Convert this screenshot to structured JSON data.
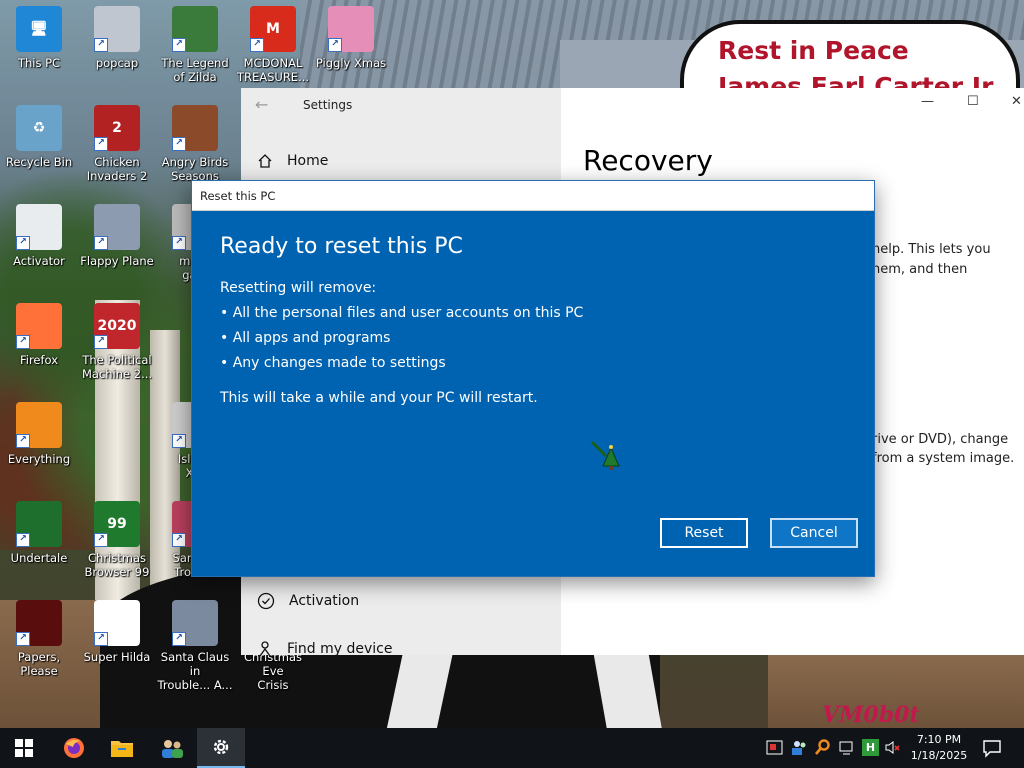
{
  "desktop": {
    "sign_line1": "Rest in Peace",
    "sign_line2": "James Earl Carter Jr.",
    "watermark": "VM0b0t",
    "icons": [
      {
        "label": "This PC",
        "color": "#1f87d6",
        "glyph": "🖥"
      },
      {
        "label": "popcap",
        "color": "#c0c6cf",
        "glyph": ""
      },
      {
        "label": "The Legend\nof Zilda",
        "color": "#3a7a3a",
        "glyph": ""
      },
      {
        "label": "MCDONAL\nTREASURE...",
        "color": "#d92b1c",
        "glyph": "M"
      },
      {
        "label": "Piggly Xmas",
        "color": "#e58fb8",
        "glyph": ""
      },
      {
        "label": "Recycle Bin",
        "color": "#6aa3c9",
        "glyph": "♻"
      },
      {
        "label": "Chicken\nInvaders 2",
        "color": "#b22222",
        "glyph": "2"
      },
      {
        "label": "Angry Birds\nSeasons",
        "color": "#8b4a2a",
        "glyph": ""
      },
      {
        "label": "Activator",
        "color": "#e9ecef",
        "glyph": ""
      },
      {
        "label": "Flappy Plane",
        "color": "#8c9bb0",
        "glyph": ""
      },
      {
        "label": "mcdo\ngam",
        "color": "#bbbbbb",
        "glyph": ""
      },
      {
        "label": "Firefox",
        "color": "#ff7139",
        "glyph": ""
      },
      {
        "label": "The Political\nMachine 2...",
        "color": "#c0272d",
        "glyph": "2020"
      },
      {
        "label": "Everything",
        "color": "#f08a1c",
        "glyph": ""
      },
      {
        "label": "Island\nXm",
        "color": "#cccccc",
        "glyph": ""
      },
      {
        "label": "Undertale",
        "color": "#1e6f2d",
        "glyph": ""
      },
      {
        "label": "Christmas\nBrowser 99",
        "color": "#1f7a2e",
        "glyph": "99"
      },
      {
        "label": "Santa C\nTrouble",
        "color": "#b8405e",
        "glyph": ""
      },
      {
        "label": "Papers, Please",
        "color": "#5a0d0d",
        "glyph": ""
      },
      {
        "label": "Super Hilda",
        "color": "#ffffff",
        "glyph": ""
      },
      {
        "label": "Santa Claus in\nTrouble... A...",
        "color": "#7c8aa0",
        "glyph": ""
      },
      {
        "label": "Christmas Eve\nCrisis",
        "color": "#5c5c5c",
        "glyph": ""
      }
    ]
  },
  "settings": {
    "window_title": "Settings",
    "nav_home": "Home",
    "nav_activation": "Activation",
    "nav_find_device": "Find my device",
    "page_title": "Recovery",
    "frag1": "help. This lets you",
    "frag2": "hem, and then",
    "frag3": "rive or DVD), change",
    "frag4": "from a system image."
  },
  "dialog": {
    "window_title": "Reset this PC",
    "heading": "Ready to reset this PC",
    "intro": "Resetting will remove:",
    "bullet1": "• All the personal files and user accounts on this PC",
    "bullet2": "• All apps and programs",
    "bullet3": "• Any changes made to settings",
    "note": "This will take a while and your PC will restart.",
    "reset_label": "Reset",
    "cancel_label": "Cancel"
  },
  "taskbar": {
    "time": "7:10 PM",
    "date": "1/18/2025",
    "tray_h_label": "H"
  },
  "colors": {
    "dialog_blue": "#0063b1",
    "taskbar": "#101418",
    "accent": "#76b9ed"
  }
}
